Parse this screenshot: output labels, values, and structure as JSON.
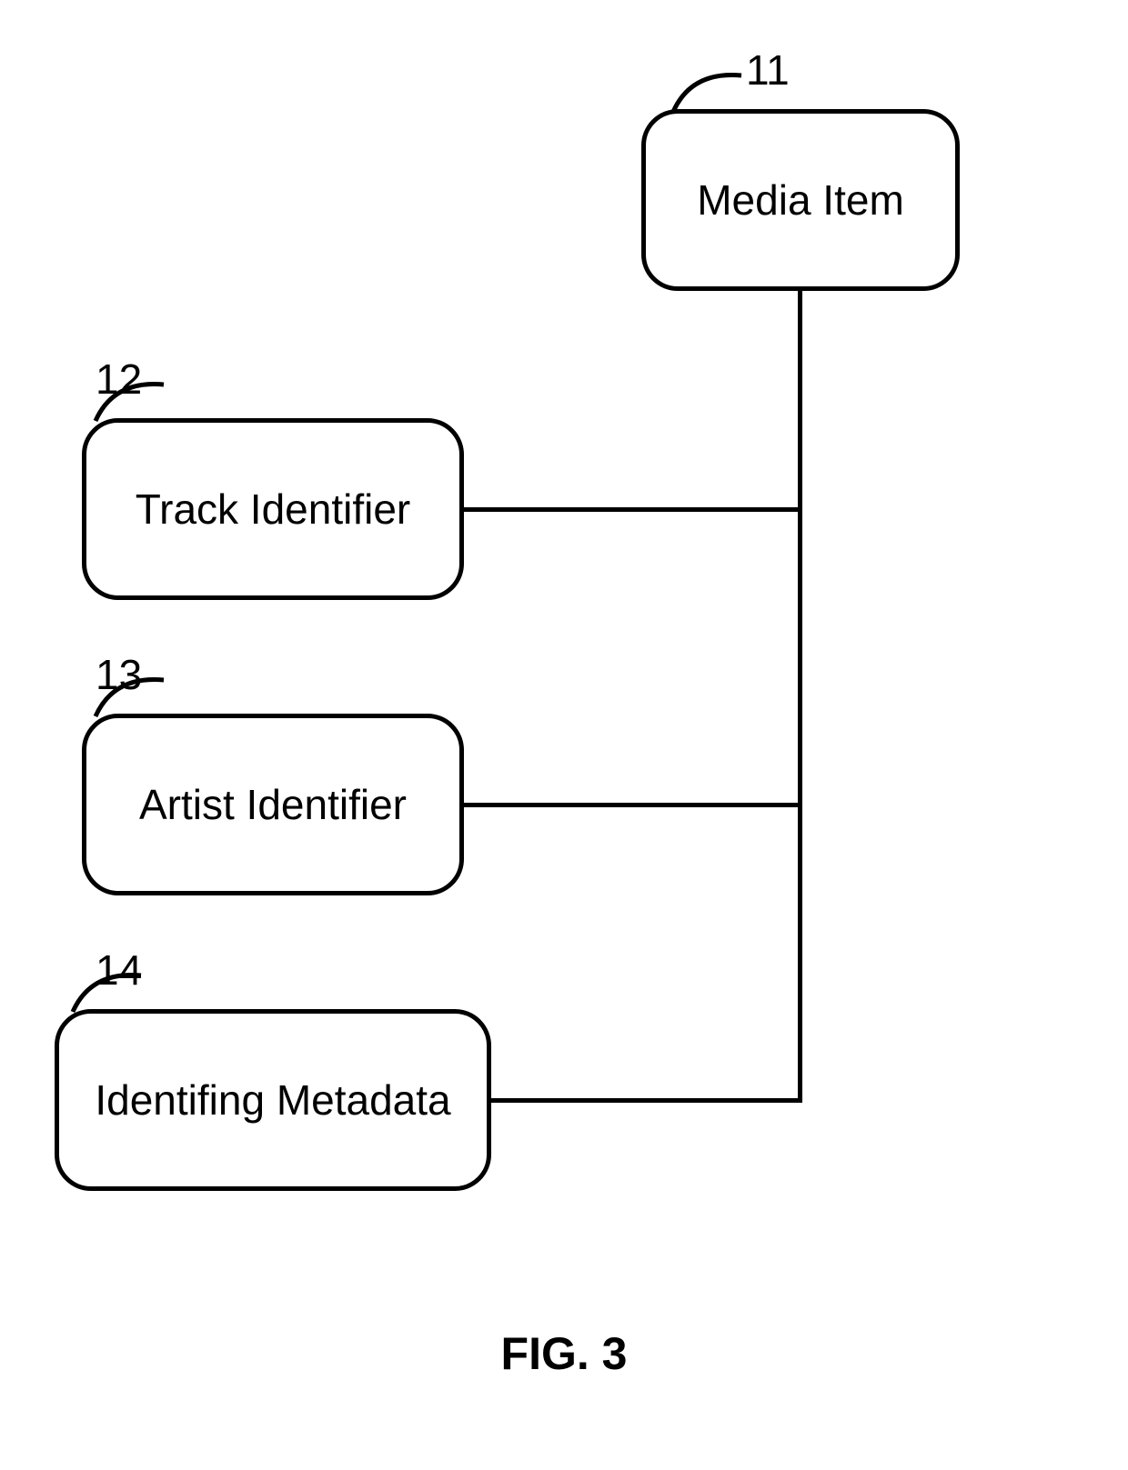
{
  "boxes": {
    "mediaItem": {
      "label": "Media Item",
      "ref": "11"
    },
    "trackIdentifier": {
      "label": "Track Identifier",
      "ref": "12"
    },
    "artistIdentifier": {
      "label": "Artist Identifier",
      "ref": "13"
    },
    "identifyingMetadata": {
      "label": "Identifing Metadata",
      "ref": "14"
    }
  },
  "figureLabel": "FIG. 3"
}
